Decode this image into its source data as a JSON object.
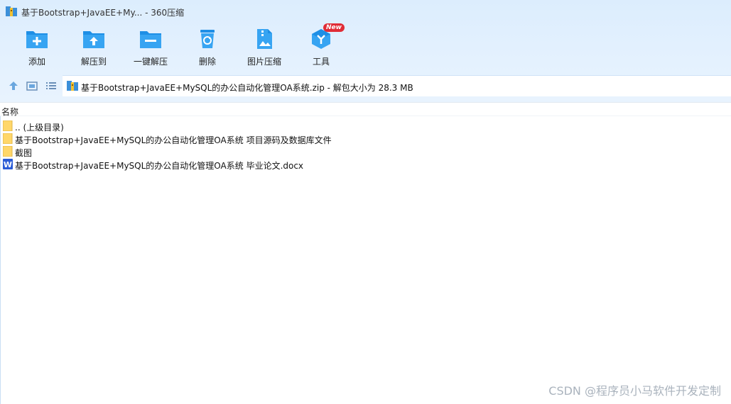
{
  "window": {
    "title": "基于Bootstrap+JavaEE+My... - 360压缩",
    "icon": "archive-icon"
  },
  "toolbar": {
    "items": [
      {
        "label": "添加",
        "icon": "folder-add-icon"
      },
      {
        "label": "解压到",
        "icon": "folder-extract-icon"
      },
      {
        "label": "一键解压",
        "icon": "folder-quick-extract-icon"
      },
      {
        "label": "删除",
        "icon": "recycle-bin-icon"
      },
      {
        "label": "图片压缩",
        "icon": "image-compress-icon"
      },
      {
        "label": "工具",
        "icon": "tools-icon"
      }
    ],
    "badge": "New"
  },
  "nav": {
    "path": "基于Bootstrap+JavaEE+MySQL的办公自动化管理OA系统.zip - 解包大小为 28.3 MB"
  },
  "list": {
    "column_name": "名称",
    "items": [
      {
        "name": ".. (上级目录)",
        "type": "folder"
      },
      {
        "name": "基于Bootstrap+JavaEE+MySQL的办公自动化管理OA系统 项目源码及数据库文件",
        "type": "folder"
      },
      {
        "name": "截图",
        "type": "folder"
      },
      {
        "name": "基于Bootstrap+JavaEE+MySQL的办公自动化管理OA系统 毕业论文.docx",
        "type": "word"
      }
    ]
  },
  "watermark": "CSDN @程序员小马软件开发定制",
  "colors": {
    "accent": "#1e8fe6",
    "folder": "#ffd76a",
    "word": "#2b5cd6",
    "badge": "#e02c36"
  }
}
